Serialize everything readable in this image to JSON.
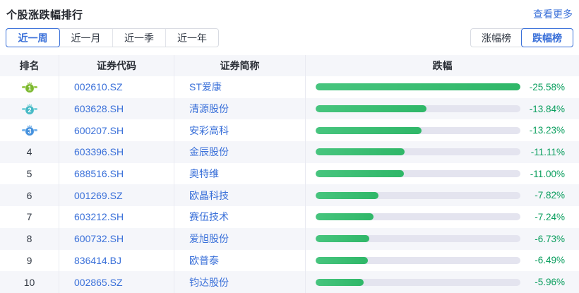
{
  "header": {
    "title": "个股涨跌幅排行",
    "more_link": "查看更多"
  },
  "filters": {
    "period_tabs": [
      {
        "key": "week",
        "label": "近一周",
        "active": true
      },
      {
        "key": "month",
        "label": "近一月",
        "active": false
      },
      {
        "key": "quarter",
        "label": "近一季",
        "active": false
      },
      {
        "key": "year",
        "label": "近一年",
        "active": false
      }
    ],
    "board_tabs": [
      {
        "key": "gainers",
        "label": "涨幅榜",
        "active": false
      },
      {
        "key": "losers",
        "label": "跌幅榜",
        "active": true
      }
    ]
  },
  "table": {
    "columns": [
      {
        "key": "rank",
        "label": "排名"
      },
      {
        "key": "code",
        "label": "证券代码"
      },
      {
        "key": "name",
        "label": "证券简称"
      },
      {
        "key": "change",
        "label": "跌幅"
      }
    ],
    "max_abs_change_pct": 25.58,
    "medals": {
      "1": {
        "fill": "#9ccb52",
        "circle": "#7bb82e"
      },
      "2": {
        "fill": "#7fd2da",
        "circle": "#46b9c6"
      },
      "3": {
        "fill": "#77b3ec",
        "circle": "#4591dd"
      }
    },
    "rows": [
      {
        "rank": "1",
        "code": "002610.SZ",
        "name": "ST爱康",
        "change_label": "-25.58%",
        "change_pct": -25.58
      },
      {
        "rank": "2",
        "code": "603628.SH",
        "name": "清源股份",
        "change_label": "-13.84%",
        "change_pct": -13.84
      },
      {
        "rank": "3",
        "code": "600207.SH",
        "name": "安彩高科",
        "change_label": "-13.23%",
        "change_pct": -13.23
      },
      {
        "rank": "4",
        "code": "603396.SH",
        "name": "金辰股份",
        "change_label": "-11.11%",
        "change_pct": -11.11
      },
      {
        "rank": "5",
        "code": "688516.SH",
        "name": "奥特维",
        "change_label": "-11.00%",
        "change_pct": -11.0
      },
      {
        "rank": "6",
        "code": "001269.SZ",
        "name": "欧晶科技",
        "change_label": "-7.82%",
        "change_pct": -7.82
      },
      {
        "rank": "7",
        "code": "603212.SH",
        "name": "赛伍技术",
        "change_label": "-7.24%",
        "change_pct": -7.24
      },
      {
        "rank": "8",
        "code": "600732.SH",
        "name": "爱旭股份",
        "change_label": "-6.73%",
        "change_pct": -6.73
      },
      {
        "rank": "9",
        "code": "836414.BJ",
        "name": "欧普泰",
        "change_label": "-6.49%",
        "change_pct": -6.49
      },
      {
        "rank": "10",
        "code": "002865.SZ",
        "name": "钧达股份",
        "change_label": "-5.96%",
        "change_pct": -5.96
      }
    ]
  },
  "colors": {
    "accent_blue": "#3a70d9",
    "bar_green": "#3bbd72",
    "bar_track": "#e4e4ef",
    "percent_green": "#0a9e5e",
    "header_bg": "#f5f6fa"
  }
}
